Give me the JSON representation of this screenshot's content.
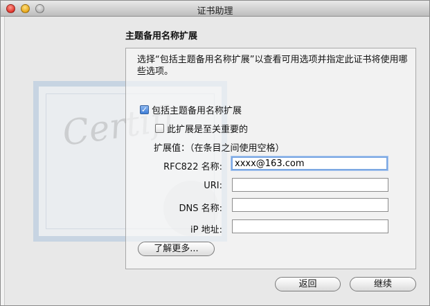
{
  "window": {
    "title": "证书助理"
  },
  "section": {
    "title": "主题备用名称扩展"
  },
  "panel": {
    "description": "选择“包括主题备用名称扩展”以查看可用选项并指定此证书将使用哪些选项。",
    "include_checkbox": {
      "label": "包括主题备用名称扩展",
      "checked": true
    },
    "critical_checkbox": {
      "label": "此扩展是至关重要的",
      "checked": false
    },
    "extension_values_label": "扩展值：（在条目之间使用空格）",
    "fields": [
      {
        "label": "RFC822 名称:",
        "value": "xxxx@163.com"
      },
      {
        "label": "URI:",
        "value": ""
      },
      {
        "label": "DNS 名称:",
        "value": ""
      },
      {
        "label": "iP 地址:",
        "value": ""
      }
    ],
    "learn_more_label": "了解更多..."
  },
  "buttons": {
    "back": "返回",
    "continue": "继续"
  },
  "watermark": {
    "script_text": "Certifi"
  }
}
